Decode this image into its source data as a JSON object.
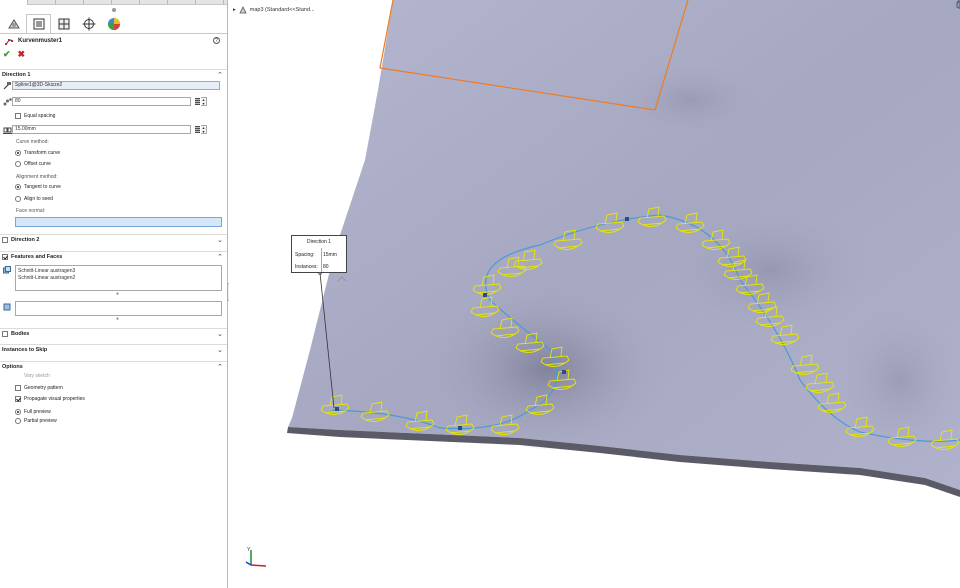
{
  "app": {
    "top_tabs": [
      "",
      "",
      "",
      "",
      "",
      "",
      "",
      "",
      "",
      ""
    ]
  },
  "feature": {
    "title": "Kurvenmuster1",
    "help_label": "?",
    "ok_label": "✔",
    "cancel_label": "✖"
  },
  "direction1": {
    "header": "Direction 1",
    "curve_ref": "Spline1@3D-Skizze2",
    "instances": "80",
    "equal_spacing_label": "Equal spacing",
    "equal_spacing_checked": false,
    "spacing": "15.00mm",
    "curve_method_label": "Curve method:",
    "transform_curve_label": "Transform curve",
    "offset_curve_label": "Offset curve",
    "alignment_method_label": "Alignment method:",
    "tangent_label": "Tangent to curve",
    "align_seed_label": "Align to seed",
    "face_normal_label": "Face normal:",
    "face_normal_value": ""
  },
  "direction2": {
    "header": "Direction 2"
  },
  "features_faces": {
    "header": "Features and Faces",
    "items": [
      "Schnitt-Linear austragen3",
      "Schnitt-Linear austragen2"
    ],
    "faces_value": ""
  },
  "bodies": {
    "header": "Bodies"
  },
  "instances_skip": {
    "header": "Instances to Skip"
  },
  "options": {
    "header": "Options",
    "vary_sketch_label": "Vary sketch",
    "geometry_pattern_label": "Geometry pattern",
    "propagate_label": "Propagate visual properties",
    "full_preview_label": "Full preview",
    "partial_preview_label": "Partial preview"
  },
  "viewport": {
    "breadcrumb": "map3 (Standard<<Stand...",
    "callout": {
      "title": "Direction 1",
      "spacing_label": "Spacing:",
      "spacing_value": "15mm",
      "instances_label": "Instances:",
      "instances_value": "80"
    }
  },
  "colors": {
    "surface": "#a9abc4",
    "pattern": "#e6e600",
    "curve": "#4a9ad8",
    "edge": "#f07a20",
    "ok": "#3a9c2f",
    "cancel": "#c8202a"
  },
  "icons": [
    "feature-manager-icon",
    "property-manager-icon",
    "configuration-manager-icon",
    "dimxpert-icon",
    "display-manager-icon",
    "curve-pattern-icon",
    "edge-reference-icon",
    "instances-icon",
    "spacing-icon",
    "features-faces-icon",
    "body-icon",
    "triad-icon"
  ]
}
